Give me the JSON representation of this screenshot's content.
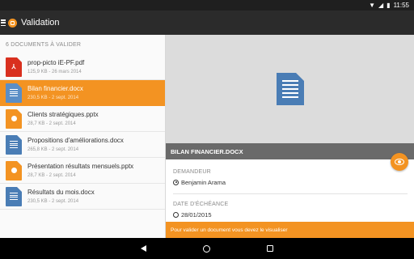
{
  "status_bar": {
    "time": "11:55",
    "icons": [
      "wifi-icon",
      "signal-icon",
      "battery-icon"
    ]
  },
  "app_bar": {
    "title": "Validation",
    "icons": [
      "menu-icon",
      "app-logo-icon"
    ]
  },
  "document_list": {
    "header": "6 DOCUMENTS À VALIDER",
    "items": [
      {
        "name": "prop-picto iE-PF.pdf",
        "meta": "125,9 KB - 26 mars 2014",
        "type": "pdf",
        "selected": false
      },
      {
        "name": "Bilan financier.docx",
        "meta": "230,5 KB - 2 sept. 2014",
        "type": "docx",
        "selected": true
      },
      {
        "name": "Clients stratégiques.pptx",
        "meta": "28,7 KB - 2 sept. 2014",
        "type": "pptx",
        "selected": false
      },
      {
        "name": "Propositions d'améliorations.docx",
        "meta": "265,8 KB - 2 sept. 2014",
        "type": "docx",
        "selected": false
      },
      {
        "name": "Présentation résultats mensuels.pptx",
        "meta": "28,7 KB - 2 sept. 2014",
        "type": "pptx",
        "selected": false
      },
      {
        "name": "Résultats du mois.docx",
        "meta": "230,5 KB - 2 sept. 2014",
        "type": "docx",
        "selected": false
      }
    ]
  },
  "detail": {
    "document_title": "BILAN FINANCIER.DOCX",
    "requester_label": "DEMANDEUR",
    "requester_value": "Benjamin Arama",
    "due_date_label": "DATE D'ÉCHÉANCE",
    "due_date_value": "28/01/2015",
    "info_message": "Pour valider un document vous devez le visualiser"
  },
  "colors": {
    "accent": "#f39322",
    "app_bar": "#2b2b2b",
    "docx_icon": "#4a7db5",
    "pdf_icon": "#d9301f",
    "title_bar": "#6a6a6a"
  }
}
